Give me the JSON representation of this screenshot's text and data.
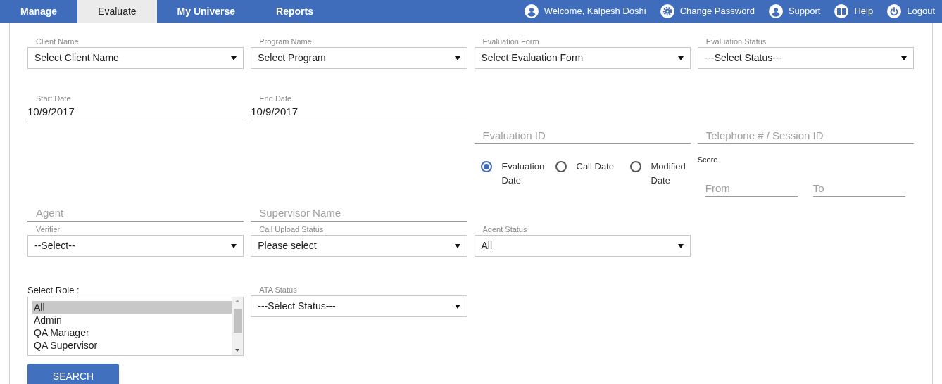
{
  "nav": {
    "tabs": [
      {
        "label": "Manage",
        "selected": false
      },
      {
        "label": "Evaluate",
        "selected": true
      },
      {
        "label": "My Universe",
        "selected": false
      },
      {
        "label": "Reports",
        "selected": false
      }
    ],
    "links": [
      {
        "label": "Welcome, Kalpesh Doshi",
        "kind": "user"
      },
      {
        "label": "Change Password",
        "kind": "gear"
      },
      {
        "label": "Support",
        "kind": "user"
      },
      {
        "label": "Help",
        "kind": "book"
      },
      {
        "label": "Logout",
        "kind": "power"
      }
    ]
  },
  "rows": [
    [
      {
        "kind": "select",
        "label": "Client Name",
        "value": "Select Client Name"
      },
      {
        "kind": "select",
        "label": "Program Name",
        "value": "Select Program"
      },
      {
        "kind": "select",
        "label": "Evaluation Form",
        "value": "Select Evaluation Form"
      },
      {
        "kind": "select",
        "label": "Evaluation Status",
        "value": "---Select Status---"
      }
    ],
    [
      {
        "kind": "date",
        "label": "Start Date",
        "value": "10/9/2017"
      },
      {
        "kind": "date",
        "label": "End Date",
        "value": "10/9/2017"
      },
      {
        "kind": "text",
        "placeholder": "Evaluation ID"
      },
      {
        "kind": "text",
        "placeholder": "Telephone # / Session ID"
      }
    ],
    [
      {
        "kind": "text",
        "placeholder": "Agent"
      },
      {
        "kind": "text",
        "placeholder": "Supervisor Name"
      },
      {
        "kind": "radio",
        "options": [
          {
            "label": "Evaluation Date",
            "selected": true
          },
          {
            "label": "Call Date",
            "selected": false
          },
          {
            "label": "Modified Date",
            "selected": false
          }
        ]
      },
      {
        "kind": "score",
        "label": "Score",
        "from_placeholder": "From",
        "to_placeholder": "To"
      }
    ],
    [
      {
        "kind": "select",
        "label": "Verifier",
        "value": "--Select--"
      },
      {
        "kind": "select",
        "label": "Call Upload Status",
        "value": "Please select"
      },
      {
        "kind": "select",
        "label": "Agent Status",
        "value": "All"
      }
    ],
    [
      {
        "kind": "listbox",
        "label": "Select Role :",
        "options": [
          {
            "label": "All",
            "selected": true
          },
          {
            "label": "Admin",
            "selected": false
          },
          {
            "label": "QA Manager",
            "selected": false
          },
          {
            "label": "QA Supervisor",
            "selected": false
          }
        ]
      },
      {
        "kind": "select",
        "label": "ATA Status",
        "value": "---Select Status---"
      }
    ]
  ],
  "search_button": "SEARCH"
}
